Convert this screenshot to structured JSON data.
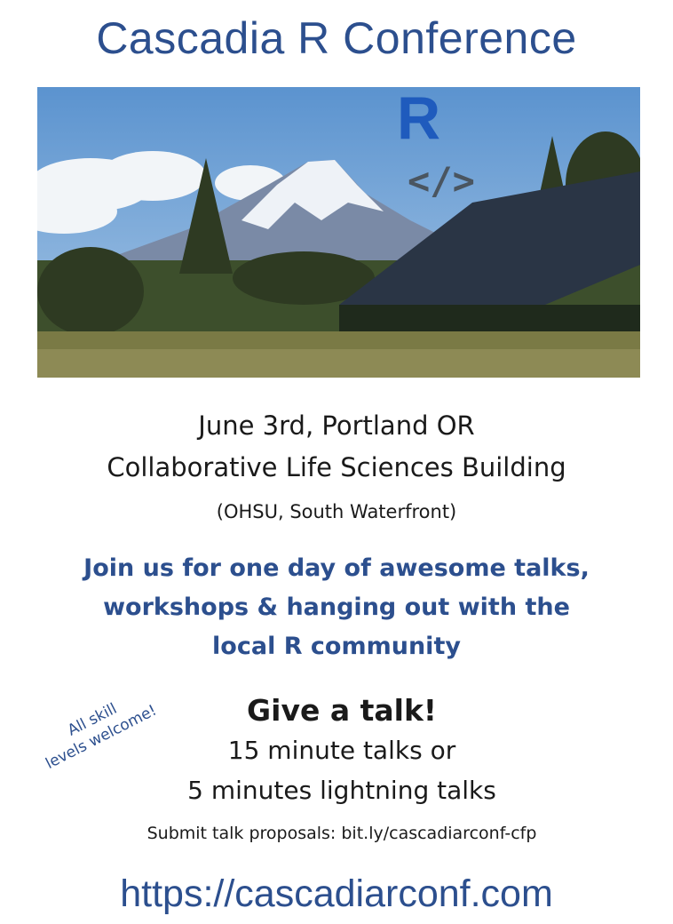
{
  "title": "Cascadia R Conference",
  "logo": {
    "letter": "R",
    "code": "</>"
  },
  "event": {
    "date_place": "June 3rd, Portland OR",
    "building": "Collaborative Life Sciences Building",
    "location_detail": "(OHSU, South Waterfront)"
  },
  "invite": {
    "line1": "Join us for one day of awesome talks,",
    "line2": "workshops & hanging out with the",
    "line3": "local R community"
  },
  "talks": {
    "heading": "Give a talk!",
    "line1": "15 minute talks or",
    "line2": "5 minutes lightning talks",
    "submit": "Submit talk proposals:  bit.ly/cascadiarconf-cfp"
  },
  "skill_note": {
    "line1": "All skill",
    "line2": "levels welcome!"
  },
  "url": "https://cascadiarconf.com"
}
